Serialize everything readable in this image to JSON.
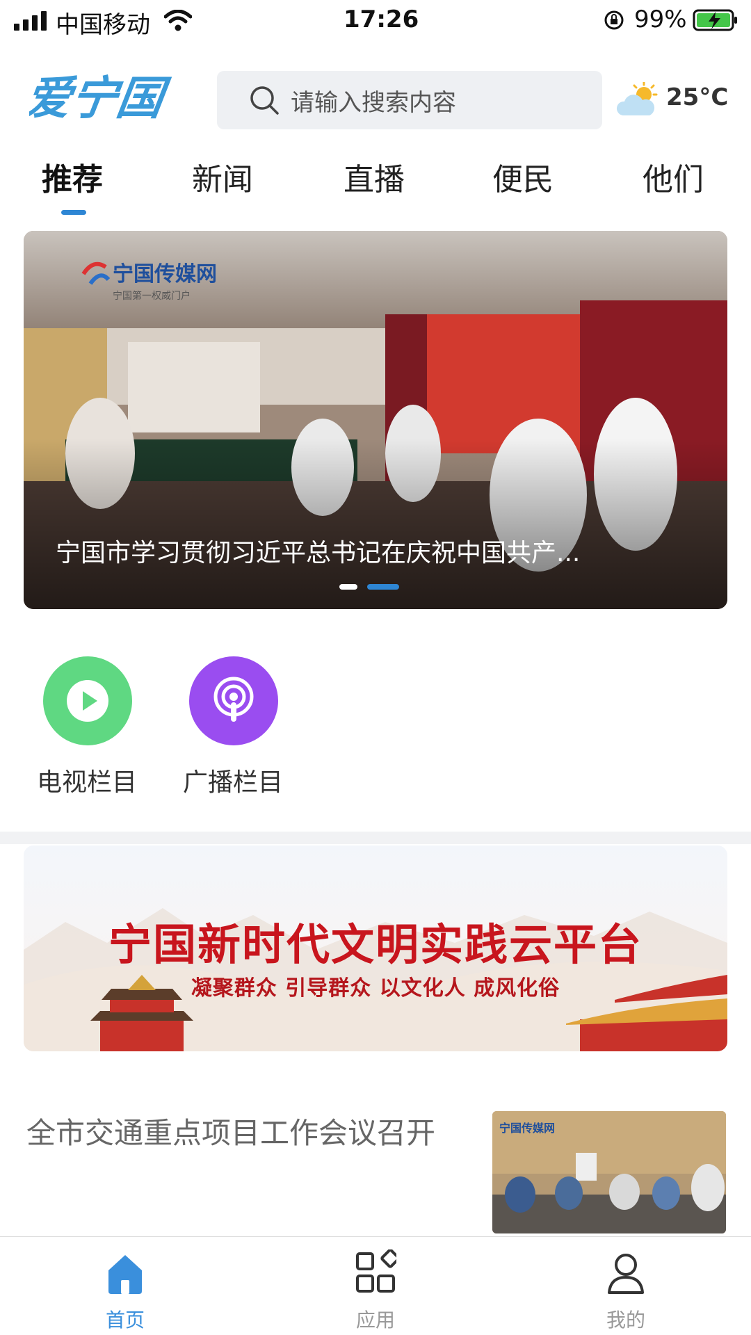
{
  "status_bar": {
    "carrier": "中国移动",
    "time": "17:26",
    "battery": "99%"
  },
  "header": {
    "logo_text": "爱宁国",
    "search_placeholder": "请输入搜索内容",
    "temperature": "25°C"
  },
  "tabs": [
    {
      "label": "推荐",
      "active": true
    },
    {
      "label": "新闻",
      "active": false
    },
    {
      "label": "直播",
      "active": false
    },
    {
      "label": "便民",
      "active": false
    },
    {
      "label": "他们",
      "active": false
    }
  ],
  "carousel": {
    "logo_text": "宁国传媒网",
    "logo_sub": "宁国第一权威门户",
    "caption": "宁国市学习贯彻习近平总书记在庆祝中国共产...",
    "slide_count": 2,
    "active_slide": 2
  },
  "quick_entries": [
    {
      "label": "电视栏目",
      "icon": "play-icon",
      "color": "#5fd882"
    },
    {
      "label": "广播栏目",
      "icon": "podcast-icon",
      "color": "#9a4df0"
    }
  ],
  "banner": {
    "title": "宁国新时代文明实践云平台",
    "subtitle": "凝聚群众 引导群众 以文化人 成风化俗"
  },
  "news": [
    {
      "title": "全市交通重点项目工作会议召开",
      "thumb_logo": "宁国传媒网"
    }
  ],
  "bottom_nav": [
    {
      "label": "首页",
      "icon": "home-icon",
      "active": true
    },
    {
      "label": "应用",
      "icon": "apps-icon",
      "active": false
    },
    {
      "label": "我的",
      "icon": "user-icon",
      "active": false
    }
  ],
  "colors": {
    "accent": "#2e86d4",
    "logo": "#3a9ad9",
    "banner_red": "#c8151d"
  }
}
